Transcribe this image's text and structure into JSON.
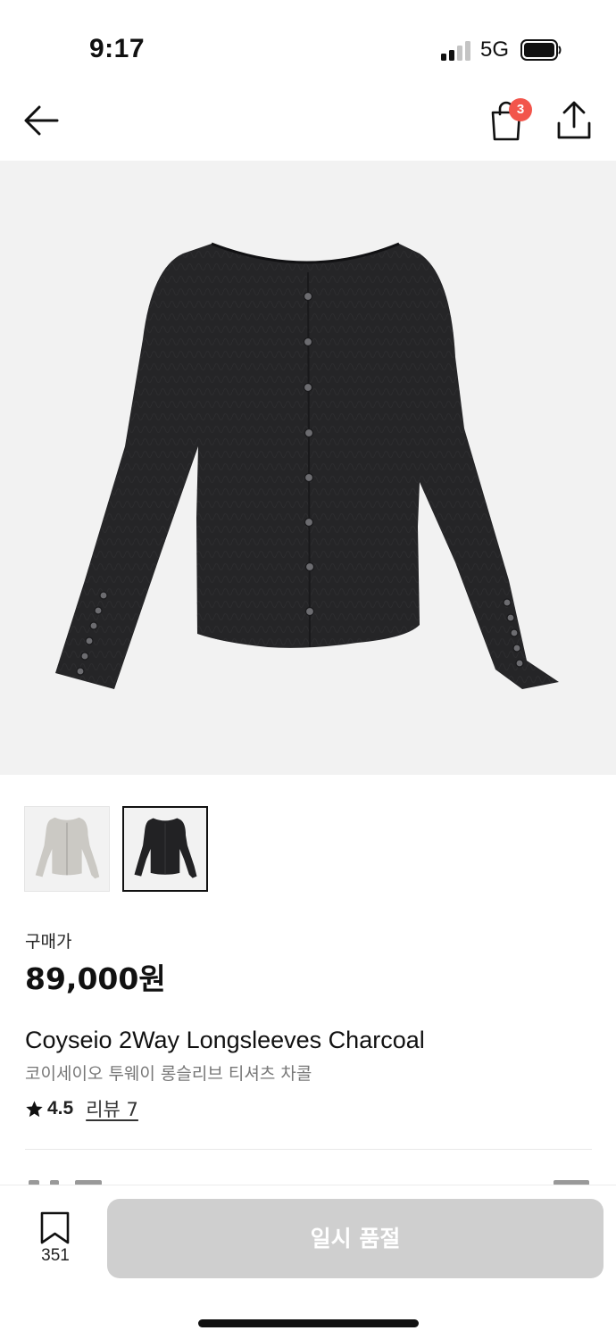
{
  "status_bar": {
    "time": "9:17",
    "network": "5G"
  },
  "nav": {
    "back_icon": "arrow-left-icon",
    "cart_icon": "shopping-bag-icon",
    "cart_badge": "3",
    "share_icon": "share-icon"
  },
  "gallery": {
    "main_image": "charcoal-cardigan-photo",
    "thumbnails": [
      {
        "name": "light-gray-cardigan",
        "selected": false
      },
      {
        "name": "charcoal-cardigan",
        "selected": true
      }
    ]
  },
  "price": {
    "label": "구매가",
    "amount": "89,000원"
  },
  "product": {
    "name_en": "Coyseio 2Way Longsleeves Charcoal",
    "name_ko": "코이세이오 투웨이 롱슬리브 티셔츠 차콜",
    "rating": "4.5",
    "review_label": "리뷰 7"
  },
  "bottom_bar": {
    "bookmark_icon": "bookmark-icon",
    "bookmark_count": "351",
    "action_label": "일시 품절"
  },
  "colors": {
    "badge": "#f2554b",
    "disabled_button": "#cfcfcf",
    "image_bg": "#f2f2f2"
  }
}
